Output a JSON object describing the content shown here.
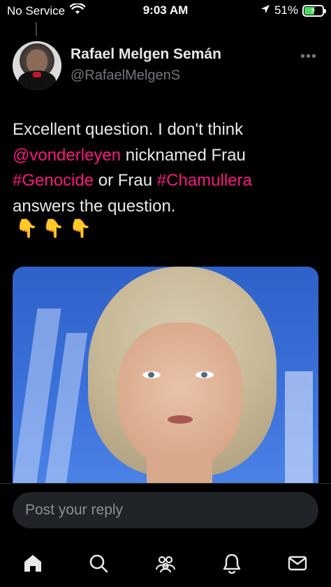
{
  "status_bar": {
    "carrier": "No Service",
    "time": "9:03 AM",
    "battery": "51%",
    "battery_level": 0.51,
    "icons": [
      "wifi-icon",
      "location-arrow-icon",
      "battery-icon"
    ]
  },
  "tweet": {
    "display_name": "Rafael Melgen Semán",
    "handle": "@RafaelMelgenS",
    "text_parts": {
      "p1": "Excellent question. I don't think",
      "mention": "@vonderleyen",
      "p2": " nicknamed Frau",
      "hashtag1": "#Genocide",
      "p3": " or Frau ",
      "hashtag2": "#Chamullera",
      "p4": "answers the question."
    },
    "emojis": "👇👇👇",
    "link_color": "#f91880"
  },
  "reply": {
    "placeholder": "Post your reply"
  },
  "tab_bar": {
    "items": [
      "home-icon",
      "search-icon",
      "communities-icon",
      "notifications-icon",
      "messages-icon"
    ]
  }
}
